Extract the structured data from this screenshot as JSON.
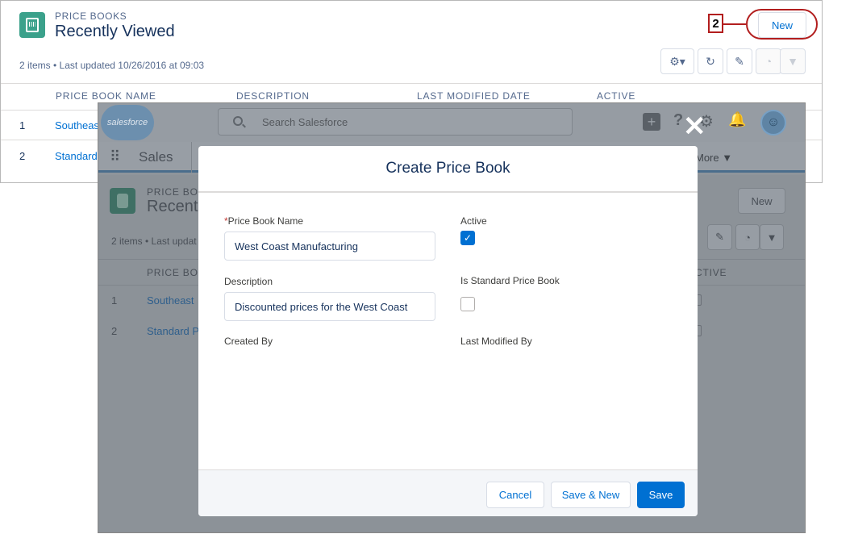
{
  "list": {
    "eyebrow": "PRICE BOOKS",
    "title": "Recently Viewed",
    "meta": "2 items • Last updated 10/26/2016 at 09:03",
    "new_label": "New",
    "columns": [
      "PRICE BOOK NAME",
      "DESCRIPTION",
      "LAST MODIFIED DATE",
      "ACTIVE"
    ],
    "rows": [
      {
        "num": "1",
        "name": "Southeas"
      },
      {
        "num": "2",
        "name": "Standard"
      }
    ]
  },
  "callout": {
    "number": "2"
  },
  "app": {
    "brand": "salesforce",
    "search_placeholder": "Search Salesforce",
    "app_name": "Sales",
    "more_label": "More ▼",
    "eyebrow": "PRICE BOO",
    "title": "Recent",
    "meta": "2 items • Last updat",
    "new_label": "New",
    "col_name": "PRICE BOO",
    "col_active": "CTIVE",
    "rows": [
      {
        "num": "1",
        "name": "Southeast"
      },
      {
        "num": "2",
        "name": "Standard P"
      }
    ]
  },
  "modal": {
    "title": "Create Price Book",
    "name_label": "Price Book Name",
    "required_mark": "*",
    "name_value": "West Coast Manufacturing",
    "active_label": "Active",
    "active_checked": true,
    "description_label": "Description",
    "description_value": "Discounted prices for the West Coast",
    "standard_label": "Is Standard Price Book",
    "standard_checked": false,
    "created_by_label": "Created By",
    "last_modified_label": "Last Modified By",
    "cancel_label": "Cancel",
    "save_new_label": "Save & New",
    "save_label": "Save"
  },
  "icons": {
    "checkmark": "✓",
    "close": "✕",
    "settings": "⚙▾",
    "refresh": "↻",
    "edit": "✎",
    "chart": "◔",
    "filter": "▼"
  },
  "colors": {
    "brand_blue": "#0070d2",
    "price_book_green": "#3ba18b",
    "callout_red": "#b21e1e"
  }
}
